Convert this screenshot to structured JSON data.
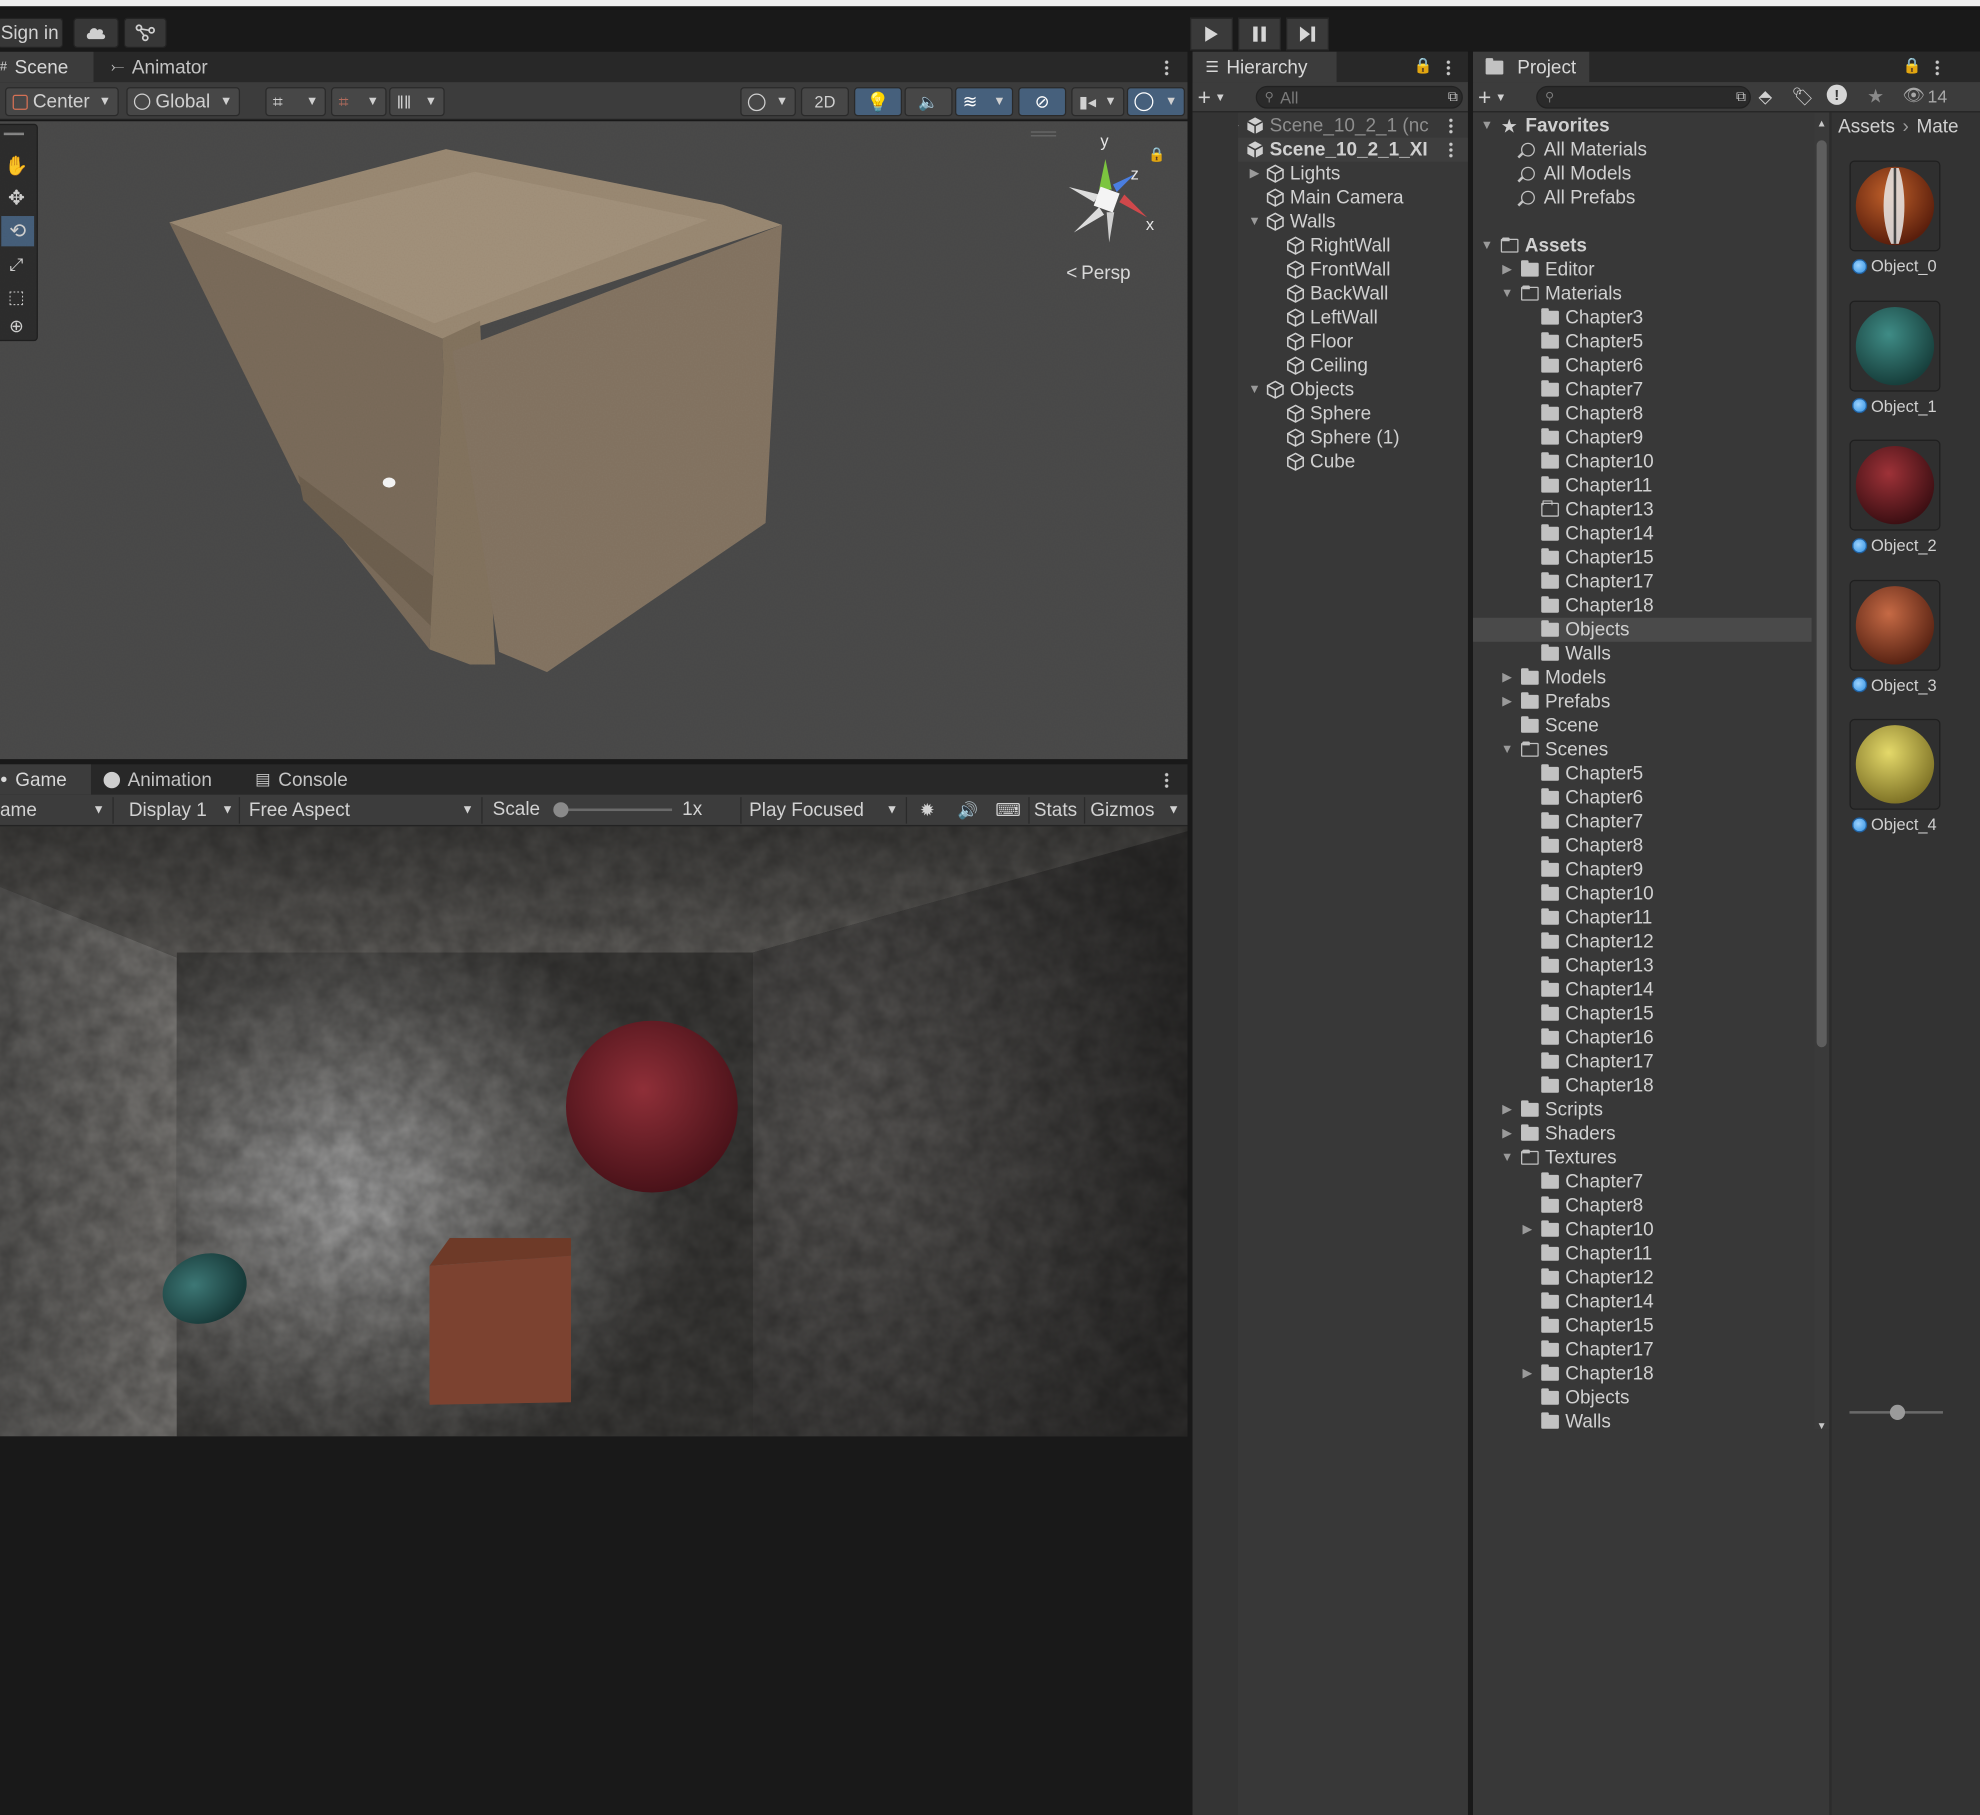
{
  "topbar": {
    "sign_in": "Sign in",
    "cloud_icon": "cloud-icon",
    "collab_icon": "collab-icon",
    "play_icon": "play-icon",
    "pause_icon": "pause-icon",
    "step_icon": "step-icon"
  },
  "scene_panel": {
    "tabs": [
      "Scene",
      "Animator"
    ],
    "toolbar": {
      "pivot": "Center",
      "space": "Global",
      "mode_2d": "2D"
    },
    "gizmo": {
      "x": "x",
      "y": "y",
      "z": "z",
      "persp": "Persp"
    },
    "tools": [
      "hand-tool-icon",
      "move-tool-icon",
      "rotate-tool-icon",
      "scale-tool-icon",
      "rect-tool-icon",
      "transform-tool-icon"
    ]
  },
  "game_panel": {
    "tabs": [
      "Game",
      "Animation",
      "Console"
    ],
    "toolbar": {
      "game_dropdown": "ame",
      "display": "Display 1",
      "aspect": "Free Aspect",
      "scale_label": "Scale",
      "scale_value": "1x",
      "play_focused": "Play Focused",
      "stats": "Stats",
      "gizmos": "Gizmos"
    }
  },
  "hierarchy": {
    "title": "Hierarchy",
    "search_placeholder": "All",
    "items": [
      {
        "label": "Scene_10_2_1 (nc",
        "depth": 0,
        "expanded": false,
        "kind": "scene",
        "dim": true
      },
      {
        "label": "Scene_10_2_1_XI",
        "depth": 0,
        "expanded": true,
        "kind": "scene",
        "bold": true
      },
      {
        "label": "Lights",
        "depth": 1,
        "expanded": false,
        "kind": "object"
      },
      {
        "label": "Main Camera",
        "depth": 1,
        "expanded": null,
        "kind": "object"
      },
      {
        "label": "Walls",
        "depth": 1,
        "expanded": true,
        "kind": "object"
      },
      {
        "label": "RightWall",
        "depth": 2,
        "expanded": null,
        "kind": "object"
      },
      {
        "label": "FrontWall",
        "depth": 2,
        "expanded": null,
        "kind": "object"
      },
      {
        "label": "BackWall",
        "depth": 2,
        "expanded": null,
        "kind": "object"
      },
      {
        "label": "LeftWall",
        "depth": 2,
        "expanded": null,
        "kind": "object"
      },
      {
        "label": "Floor",
        "depth": 2,
        "expanded": null,
        "kind": "object"
      },
      {
        "label": "Ceiling",
        "depth": 2,
        "expanded": null,
        "kind": "object"
      },
      {
        "label": "Objects",
        "depth": 1,
        "expanded": true,
        "kind": "object"
      },
      {
        "label": "Sphere",
        "depth": 2,
        "expanded": null,
        "kind": "object"
      },
      {
        "label": "Sphere (1)",
        "depth": 2,
        "expanded": null,
        "kind": "object"
      },
      {
        "label": "Cube",
        "depth": 2,
        "expanded": null,
        "kind": "object"
      }
    ]
  },
  "project": {
    "title": "Project",
    "hidden_count": "14",
    "breadcrumb": [
      "Assets",
      "Mate"
    ],
    "tree": [
      {
        "label": "Favorites",
        "depth": 0,
        "expanded": true,
        "kind": "star",
        "bold": true
      },
      {
        "label": "All Materials",
        "depth": 1,
        "expanded": null,
        "kind": "search"
      },
      {
        "label": "All Models",
        "depth": 1,
        "expanded": null,
        "kind": "search"
      },
      {
        "label": "All Prefabs",
        "depth": 1,
        "expanded": null,
        "kind": "search"
      },
      {
        "label": "",
        "depth": 0,
        "expanded": null,
        "kind": "spacer"
      },
      {
        "label": "Assets",
        "depth": 0,
        "expanded": true,
        "kind": "folder-open",
        "bold": true
      },
      {
        "label": "Editor",
        "depth": 1,
        "expanded": false,
        "kind": "folder"
      },
      {
        "label": "Materials",
        "depth": 1,
        "expanded": true,
        "kind": "folder-open"
      },
      {
        "label": "Chapter3",
        "depth": 2,
        "expanded": null,
        "kind": "folder"
      },
      {
        "label": "Chapter5",
        "depth": 2,
        "expanded": null,
        "kind": "folder"
      },
      {
        "label": "Chapter6",
        "depth": 2,
        "expanded": null,
        "kind": "folder"
      },
      {
        "label": "Chapter7",
        "depth": 2,
        "expanded": null,
        "kind": "folder"
      },
      {
        "label": "Chapter8",
        "depth": 2,
        "expanded": null,
        "kind": "folder"
      },
      {
        "label": "Chapter9",
        "depth": 2,
        "expanded": null,
        "kind": "folder"
      },
      {
        "label": "Chapter10",
        "depth": 2,
        "expanded": null,
        "kind": "folder"
      },
      {
        "label": "Chapter11",
        "depth": 2,
        "expanded": null,
        "kind": "folder"
      },
      {
        "label": "Chapter13",
        "depth": 2,
        "expanded": null,
        "kind": "folder-empty"
      },
      {
        "label": "Chapter14",
        "depth": 2,
        "expanded": null,
        "kind": "folder"
      },
      {
        "label": "Chapter15",
        "depth": 2,
        "expanded": null,
        "kind": "folder"
      },
      {
        "label": "Chapter17",
        "depth": 2,
        "expanded": null,
        "kind": "folder"
      },
      {
        "label": "Chapter18",
        "depth": 2,
        "expanded": null,
        "kind": "folder"
      },
      {
        "label": "Objects",
        "depth": 2,
        "expanded": null,
        "kind": "folder",
        "selected": true
      },
      {
        "label": "Walls",
        "depth": 2,
        "expanded": null,
        "kind": "folder"
      },
      {
        "label": "Models",
        "depth": 1,
        "expanded": false,
        "kind": "folder"
      },
      {
        "label": "Prefabs",
        "depth": 1,
        "expanded": false,
        "kind": "folder"
      },
      {
        "label": "Scene",
        "depth": 1,
        "expanded": null,
        "kind": "folder"
      },
      {
        "label": "Scenes",
        "depth": 1,
        "expanded": true,
        "kind": "folder-open"
      },
      {
        "label": "Chapter5",
        "depth": 2,
        "expanded": null,
        "kind": "folder"
      },
      {
        "label": "Chapter6",
        "depth": 2,
        "expanded": null,
        "kind": "folder"
      },
      {
        "label": "Chapter7",
        "depth": 2,
        "expanded": null,
        "kind": "folder"
      },
      {
        "label": "Chapter8",
        "depth": 2,
        "expanded": null,
        "kind": "folder"
      },
      {
        "label": "Chapter9",
        "depth": 2,
        "expanded": null,
        "kind": "folder"
      },
      {
        "label": "Chapter10",
        "depth": 2,
        "expanded": null,
        "kind": "folder"
      },
      {
        "label": "Chapter11",
        "depth": 2,
        "expanded": null,
        "kind": "folder"
      },
      {
        "label": "Chapter12",
        "depth": 2,
        "expanded": null,
        "kind": "folder"
      },
      {
        "label": "Chapter13",
        "depth": 2,
        "expanded": null,
        "kind": "folder"
      },
      {
        "label": "Chapter14",
        "depth": 2,
        "expanded": null,
        "kind": "folder"
      },
      {
        "label": "Chapter15",
        "depth": 2,
        "expanded": null,
        "kind": "folder"
      },
      {
        "label": "Chapter16",
        "depth": 2,
        "expanded": null,
        "kind": "folder"
      },
      {
        "label": "Chapter17",
        "depth": 2,
        "expanded": null,
        "kind": "folder"
      },
      {
        "label": "Chapter18",
        "depth": 2,
        "expanded": null,
        "kind": "folder"
      },
      {
        "label": "Scripts",
        "depth": 1,
        "expanded": false,
        "kind": "folder"
      },
      {
        "label": "Shaders",
        "depth": 1,
        "expanded": false,
        "kind": "folder"
      },
      {
        "label": "Textures",
        "depth": 1,
        "expanded": true,
        "kind": "folder-open"
      },
      {
        "label": "Chapter7",
        "depth": 2,
        "expanded": null,
        "kind": "folder"
      },
      {
        "label": "Chapter8",
        "depth": 2,
        "expanded": null,
        "kind": "folder"
      },
      {
        "label": "Chapter10",
        "depth": 2,
        "expanded": false,
        "kind": "folder"
      },
      {
        "label": "Chapter11",
        "depth": 2,
        "expanded": null,
        "kind": "folder"
      },
      {
        "label": "Chapter12",
        "depth": 2,
        "expanded": null,
        "kind": "folder"
      },
      {
        "label": "Chapter14",
        "depth": 2,
        "expanded": null,
        "kind": "folder"
      },
      {
        "label": "Chapter15",
        "depth": 2,
        "expanded": null,
        "kind": "folder"
      },
      {
        "label": "Chapter17",
        "depth": 2,
        "expanded": null,
        "kind": "folder"
      },
      {
        "label": "Chapter18",
        "depth": 2,
        "expanded": false,
        "kind": "folder"
      },
      {
        "label": "Objects",
        "depth": 2,
        "expanded": null,
        "kind": "folder"
      },
      {
        "label": "Walls",
        "depth": 2,
        "expanded": null,
        "kind": "folder"
      }
    ],
    "assets": [
      {
        "label": "Object_0",
        "color_a": "#c0602a",
        "color_b": "#5a1e0c",
        "striped": true
      },
      {
        "label": "Object_1",
        "color_a": "#3f8c86",
        "color_b": "#173f3c",
        "striped": false
      },
      {
        "label": "Object_2",
        "color_a": "#9e3238",
        "color_b": "#3d0f13",
        "striped": false
      },
      {
        "label": "Object_3",
        "color_a": "#c66a45",
        "color_b": "#5a2414",
        "striped": false
      },
      {
        "label": "Object_4",
        "color_a": "#e4d96a",
        "color_b": "#807427",
        "striped": false
      }
    ]
  },
  "colors": {
    "accent_selected_tool": "#46607c",
    "folder_icon": "#c2c2c2",
    "selected_row": "#4a4a4a"
  }
}
